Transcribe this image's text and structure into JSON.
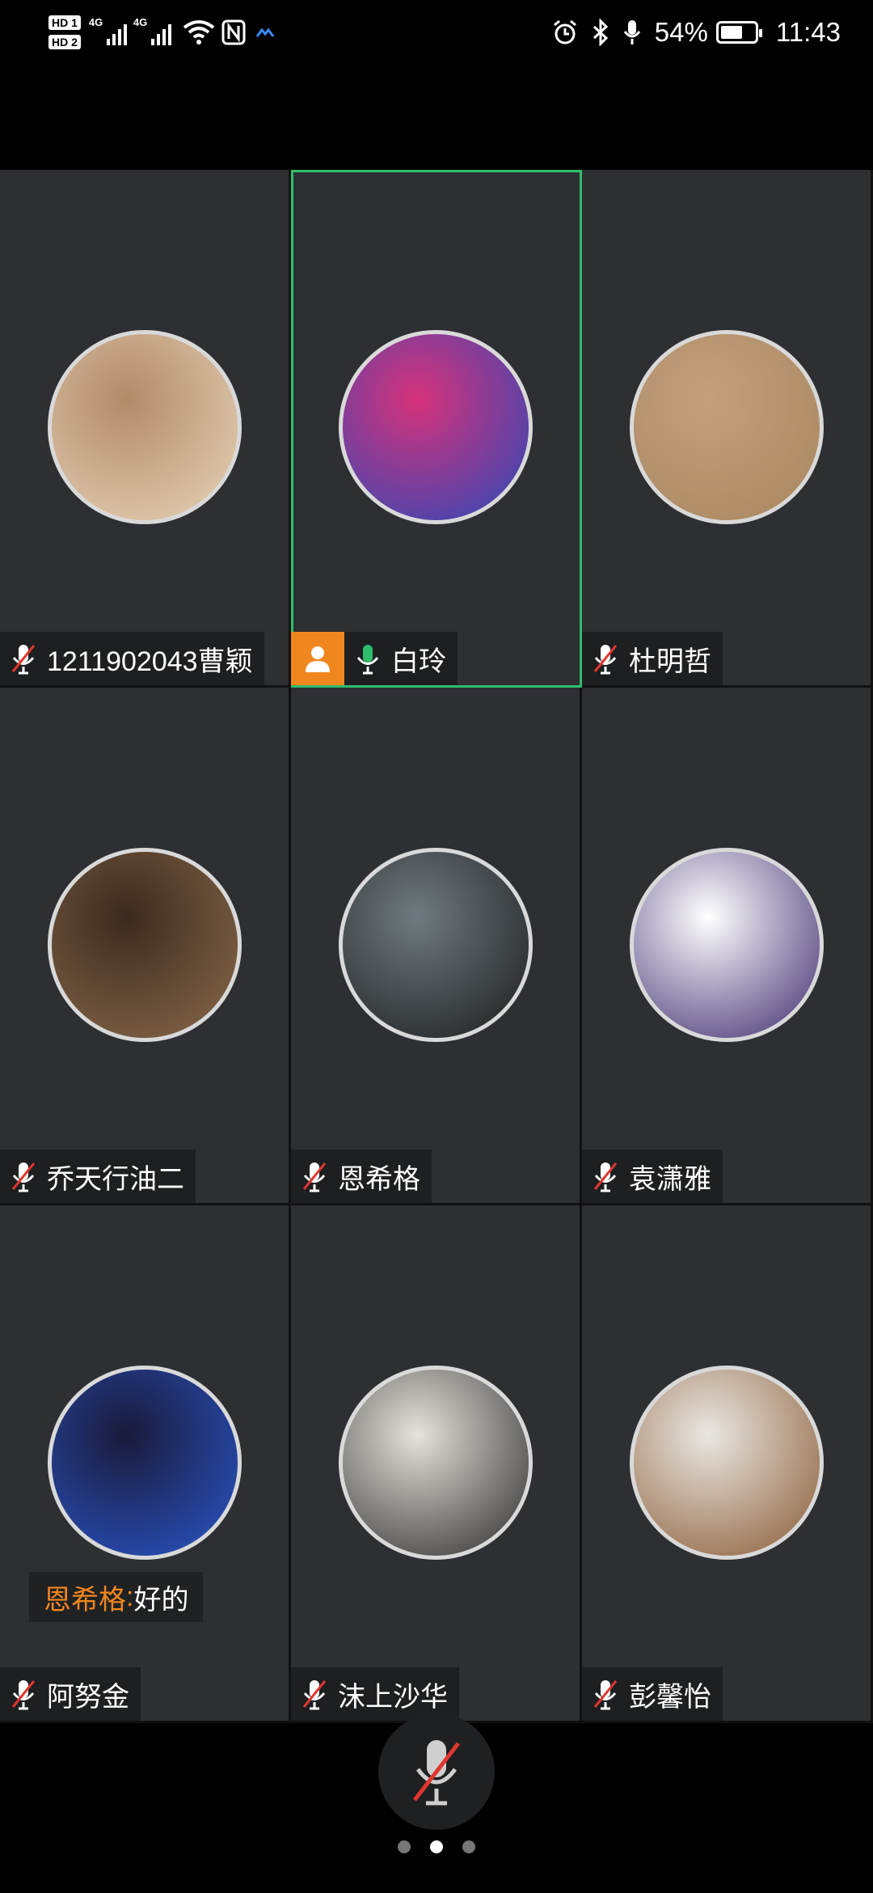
{
  "status_bar": {
    "hd1": "HD 1",
    "hd2": "HD 2",
    "net1": "4G",
    "net2": "4G",
    "battery": "54%",
    "time": "11:43"
  },
  "participants": [
    {
      "name": "1211902043曹颖",
      "mic": "muted",
      "host": false,
      "avatar_colors": [
        "#b28a6a",
        "#e8d4b8"
      ]
    },
    {
      "name": "白玲",
      "mic": "on",
      "host": true,
      "active_speaker": true,
      "avatar_colors": [
        "#d6327a",
        "#2a49b8"
      ]
    },
    {
      "name": "杜明哲",
      "mic": "muted",
      "host": false,
      "avatar_colors": [
        "#c2a07d",
        "#a8865f"
      ]
    },
    {
      "name": "乔天行油二",
      "mic": "muted",
      "host": false,
      "avatar_colors": [
        "#3b2a1f",
        "#8a6a4a"
      ]
    },
    {
      "name": "恩希格",
      "mic": "muted",
      "host": false,
      "avatar_colors": [
        "#6f7a80",
        "#1c1c1c"
      ]
    },
    {
      "name": "袁潇雅",
      "mic": "muted",
      "host": false,
      "avatar_colors": [
        "#ffffff",
        "#3d2b6e"
      ]
    },
    {
      "name": "阿努金",
      "mic": "muted",
      "host": false,
      "avatar_colors": [
        "#1a1a3a",
        "#2a56c9"
      ]
    },
    {
      "name": "沫上沙华",
      "mic": "muted",
      "host": false,
      "avatar_colors": [
        "#e6e2dc",
        "#2b2b2b"
      ]
    },
    {
      "name": "彭馨怡",
      "mic": "muted",
      "host": false,
      "avatar_colors": [
        "#e9e7e3",
        "#8a5a33"
      ]
    }
  ],
  "chat_overlay": {
    "sender": "恩希格",
    "separator": ":",
    "message": " 好的"
  },
  "colors": {
    "host_badge": "#f0861e",
    "active_border": "#2ebd6b",
    "mic_on": "#2ebd6b",
    "mic_muted_slash": "#e0362f"
  },
  "pager": {
    "pages": 3,
    "current": 2
  }
}
